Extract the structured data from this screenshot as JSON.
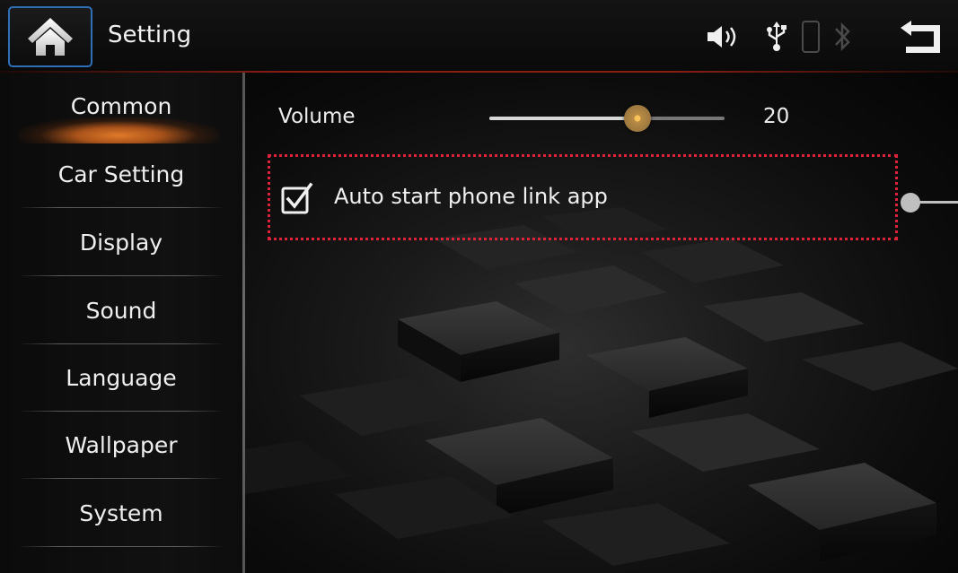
{
  "header": {
    "title": "Setting",
    "home_icon": "home-icon",
    "back_icon": "back-icon",
    "status_icons": [
      "speaker-icon",
      "usb-icon",
      "phone-icon",
      "bluetooth-icon"
    ]
  },
  "sidebar": {
    "items": [
      {
        "label": "Common",
        "active": true
      },
      {
        "label": "Car Setting",
        "active": false
      },
      {
        "label": "Display",
        "active": false
      },
      {
        "label": "Sound",
        "active": false
      },
      {
        "label": "Language",
        "active": false
      },
      {
        "label": "Wallpaper",
        "active": false
      },
      {
        "label": "System",
        "active": false
      }
    ]
  },
  "main": {
    "volume": {
      "label": "Volume",
      "value": "20",
      "fraction": 0.63
    },
    "auto_start": {
      "label": "Auto start phone link app",
      "checked": true
    }
  },
  "colors": {
    "accent_orange": "#e07a2a",
    "home_border": "#2f6fb7",
    "callout_red": "#e0223c",
    "header_line": "#8a1e12"
  }
}
